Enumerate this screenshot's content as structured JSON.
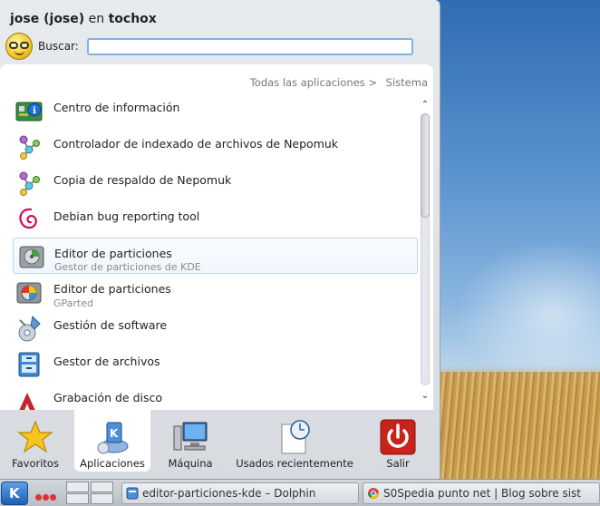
{
  "header": {
    "user_display": "jose (jose)",
    "on_text": "en",
    "host": "tochox"
  },
  "search": {
    "label": "Buscar:",
    "value": "",
    "placeholder": ""
  },
  "breadcrumb": {
    "root": "Todas las aplicaciones >",
    "current": "Sistema"
  },
  "apps": [
    {
      "name": "Centro de información",
      "subtitle": "",
      "icon": "info-center-icon"
    },
    {
      "name": "Controlador de indexado de archivos de Nepomuk",
      "subtitle": "",
      "icon": "nepomuk-icon"
    },
    {
      "name": "Copia de respaldo de Nepomuk",
      "subtitle": "",
      "icon": "nepomuk-icon"
    },
    {
      "name": "Debian bug reporting tool",
      "subtitle": "",
      "icon": "debian-swirl-icon"
    },
    {
      "name": "Editor de particiones",
      "subtitle": "Gestor de particiones de KDE",
      "icon": "partition-manager-icon"
    },
    {
      "name": "Editor de particiones",
      "subtitle": "GParted",
      "icon": "gparted-icon"
    },
    {
      "name": "Gestión de software",
      "subtitle": "",
      "icon": "software-management-icon"
    },
    {
      "name": "Gestor de archivos",
      "subtitle": "",
      "icon": "file-manager-icon"
    },
    {
      "name": "Grabación de disco",
      "subtitle": "",
      "icon": "disc-burning-icon"
    }
  ],
  "selected_index": 4,
  "tabs": [
    {
      "label": "Favoritos",
      "icon": "star-icon",
      "active": false
    },
    {
      "label": "Aplicaciones",
      "icon": "applications-icon",
      "active": true
    },
    {
      "label": "Máquina",
      "icon": "computer-icon",
      "active": false
    },
    {
      "label": "Usados recientemente",
      "icon": "recent-document-icon",
      "active": false
    },
    {
      "label": "Salir",
      "icon": "power-icon",
      "active": false
    }
  ],
  "taskbar": {
    "start_glyph": "K",
    "tasks": [
      {
        "title": "editor-particiones-kde – Dolphin",
        "icon": "dolphin-icon"
      },
      {
        "title": "S0Spedia punto net | Blog sobre sist",
        "icon": "chrome-icon"
      }
    ]
  },
  "colors": {
    "search_border": "#7fb2e5",
    "selected_border": "#bcd6ee",
    "kde_blue": "#1f5fb4",
    "power_red": "#c8221a"
  }
}
